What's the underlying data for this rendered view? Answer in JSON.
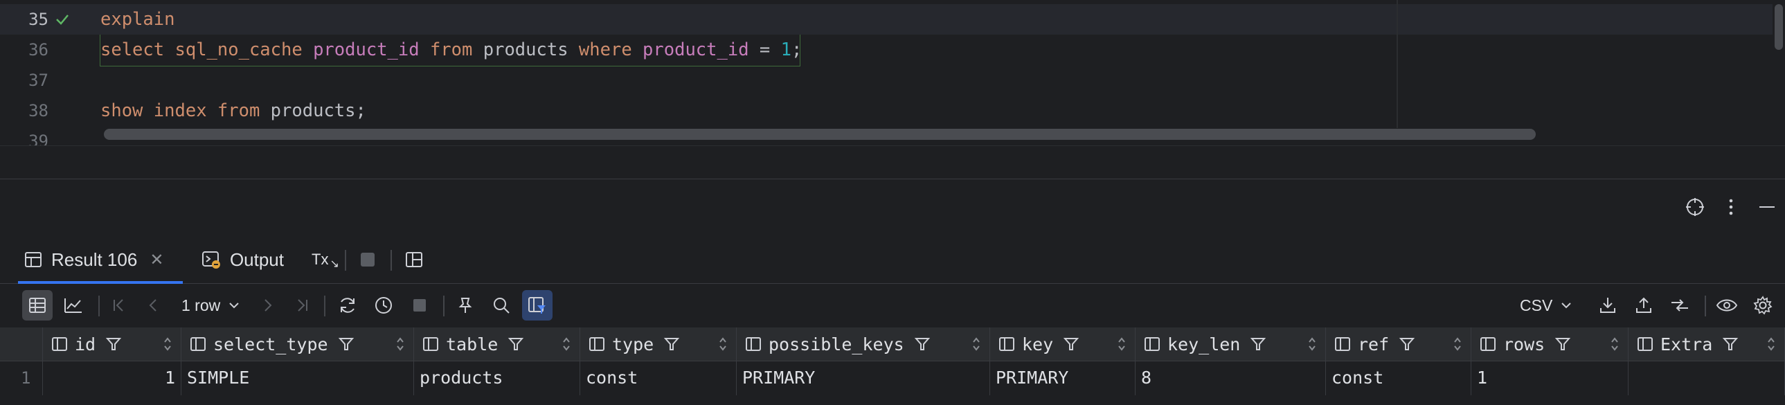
{
  "editor": {
    "lines": [
      {
        "num": "35",
        "status": "check-icon",
        "tokens": [
          {
            "t": "explain",
            "c": "kw"
          }
        ]
      },
      {
        "num": "36",
        "tokens": [
          {
            "t": "select",
            "c": "kw"
          },
          {
            "t": " "
          },
          {
            "t": "sql_no_cache",
            "c": "kw"
          },
          {
            "t": " "
          },
          {
            "t": "product_id",
            "c": "fn"
          },
          {
            "t": " "
          },
          {
            "t": "from",
            "c": "kw"
          },
          {
            "t": " products "
          },
          {
            "t": "where",
            "c": "kw"
          },
          {
            "t": " "
          },
          {
            "t": "product_id",
            "c": "fn"
          },
          {
            "t": " = "
          },
          {
            "t": "1",
            "c": "num"
          },
          {
            "t": ";"
          }
        ]
      },
      {
        "num": "37",
        "tokens": []
      },
      {
        "num": "38",
        "tokens": [
          {
            "t": "show",
            "c": "kw"
          },
          {
            "t": " "
          },
          {
            "t": "index",
            "c": "kw"
          },
          {
            "t": " "
          },
          {
            "t": "from",
            "c": "kw"
          },
          {
            "t": " products;"
          }
        ]
      },
      {
        "num": "39",
        "tokens": []
      }
    ]
  },
  "panel": {
    "tabs": [
      {
        "label": "Result 106",
        "icon": "table-icon",
        "closable": true,
        "active": true
      },
      {
        "label": "Output",
        "icon": "output-icon",
        "closable": false,
        "active": false
      }
    ],
    "tab_tools": [
      {
        "label": "Tx",
        "icon": "transaction-mode-icon"
      },
      {
        "icon": "stop-icon"
      },
      {
        "icon": "layout-icon"
      }
    ],
    "window_tools": [
      "target-icon",
      "more-vertical-icon",
      "minimize-icon"
    ]
  },
  "toolbar": {
    "rows_label": "1 row",
    "format_label": "CSV"
  },
  "grid": {
    "columns": [
      {
        "name": "id",
        "align": "right"
      },
      {
        "name": "select_type"
      },
      {
        "name": "table"
      },
      {
        "name": "type"
      },
      {
        "name": "possible_keys"
      },
      {
        "name": "key"
      },
      {
        "name": "key_len"
      },
      {
        "name": "ref"
      },
      {
        "name": "rows"
      },
      {
        "name": "Extra"
      }
    ],
    "rows": [
      {
        "num": "1",
        "cells": [
          "1",
          "SIMPLE",
          "products",
          "const",
          "PRIMARY",
          "PRIMARY",
          "8",
          "const",
          "1",
          ""
        ]
      }
    ]
  },
  "colors": {
    "keyword": "#cf8e6d",
    "identifier": "#c77dbb",
    "number": "#2aacb8",
    "accent": "#3574f0",
    "success": "#5fb865"
  }
}
